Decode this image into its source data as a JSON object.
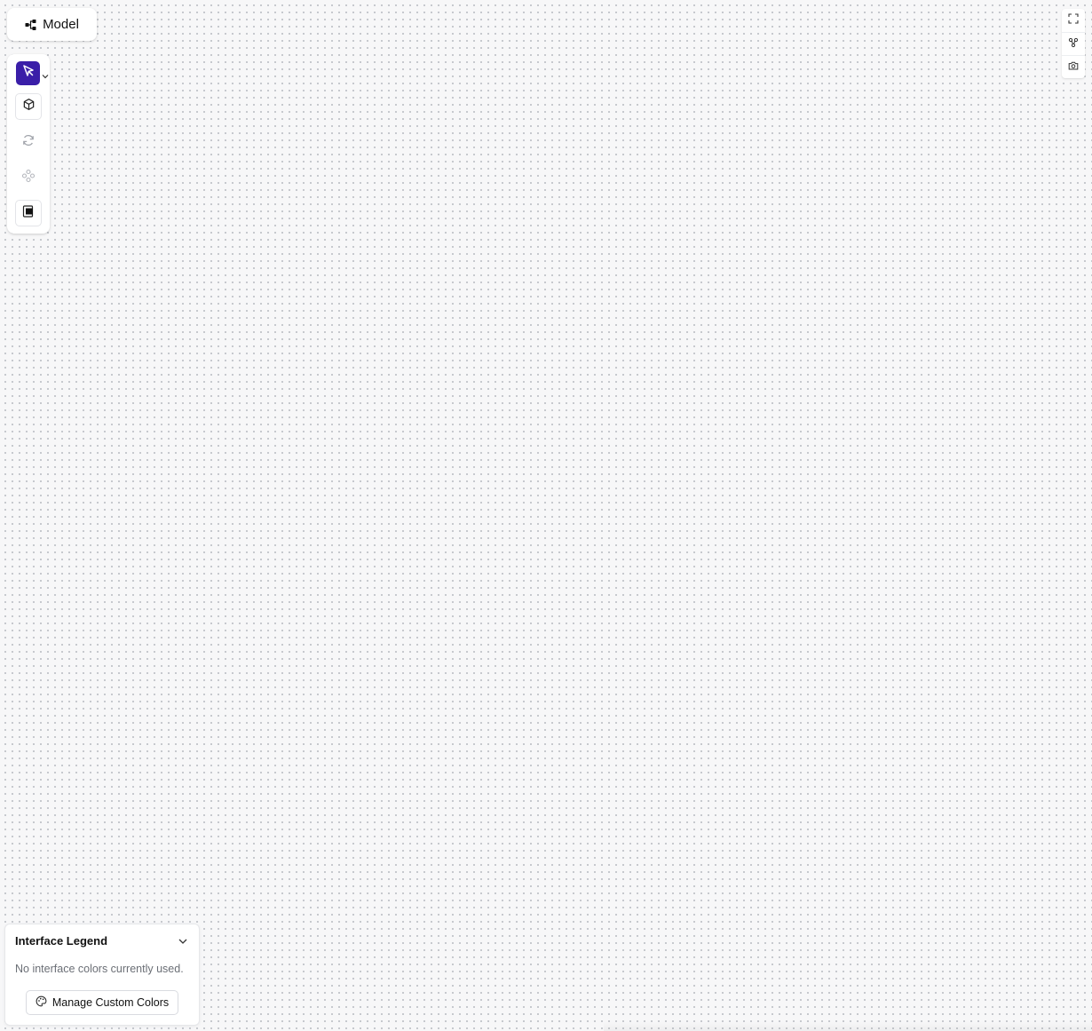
{
  "header": {
    "model_label": "Model"
  },
  "tools": {
    "items": [
      {
        "name": "select",
        "icon": "cursor-icon",
        "active": true
      },
      {
        "name": "cube",
        "icon": "cube-icon",
        "active": false
      },
      {
        "name": "refresh",
        "icon": "refresh-icon",
        "active": false,
        "disabled": true
      },
      {
        "name": "move",
        "icon": "move-icon",
        "active": false,
        "disabled": true
      },
      {
        "name": "fill",
        "icon": "fill-icon",
        "active": false
      }
    ]
  },
  "view_tools": {
    "items": [
      {
        "name": "fit-view",
        "icon": "fullscreen-icon"
      },
      {
        "name": "layout",
        "icon": "layout-icon"
      },
      {
        "name": "screenshot",
        "icon": "camera-icon"
      }
    ]
  },
  "legend": {
    "title": "Interface Legend",
    "empty_text": "No interface colors currently used.",
    "manage_label": "Manage Custom Colors"
  },
  "colors": {
    "accent": "#3a1ea8",
    "canvas_bg": "#f7f7f8",
    "grid_dot": "#b9bcc2"
  }
}
